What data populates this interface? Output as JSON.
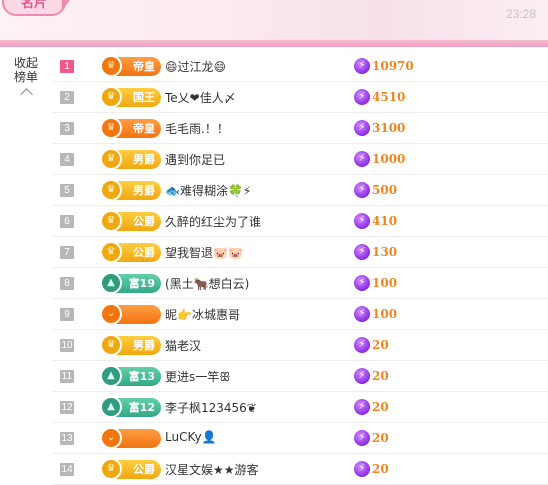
{
  "header": {
    "tag": "名片",
    "time": "23:28",
    "accent": "#f28ab0"
  },
  "sidebar": {
    "line1": "收起",
    "line2": "榜单",
    "icon": "chevron-up-icon"
  },
  "rows": [
    {
      "rank": "1",
      "badge": "帝皇",
      "badge_color": "orange",
      "badge_icon": "crown-icon",
      "name": "😄过江龙😄",
      "score": "10970"
    },
    {
      "rank": "2",
      "badge": "国王",
      "badge_color": "gold",
      "badge_icon": "crown-icon",
      "name": "Te乂❤佳人〆",
      "score": "4510"
    },
    {
      "rank": "3",
      "badge": "帝皇",
      "badge_color": "orange",
      "badge_icon": "crown-icon",
      "name": "毛毛雨.！！",
      "score": "3100"
    },
    {
      "rank": "4",
      "badge": "男爵",
      "badge_color": "gold",
      "badge_icon": "crown-icon",
      "name": "遇到你足已",
      "score": "1000"
    },
    {
      "rank": "5",
      "badge": "男爵",
      "badge_color": "gold",
      "badge_icon": "crown-icon",
      "name": "🐟难得糊涂🍀⚡",
      "score": "500"
    },
    {
      "rank": "6",
      "badge": "公爵",
      "badge_color": "gold",
      "badge_icon": "crown-icon",
      "name": "久醉的红尘为了谁",
      "score": "410"
    },
    {
      "rank": "7",
      "badge": "公爵",
      "badge_color": "gold",
      "badge_icon": "crown-icon",
      "name": "望我智退🐷🐷",
      "score": "130"
    },
    {
      "rank": "8",
      "badge": "富19",
      "badge_color": "teal",
      "badge_icon": "triangle-icon",
      "name": "(黑土🐂想白云)",
      "score": "100"
    },
    {
      "rank": "9",
      "badge": "",
      "badge_color": "orange",
      "badge_icon": "chevron-icon",
      "name": "昵👉冰城惠哥",
      "score": "100"
    },
    {
      "rank": "10",
      "badge": "男爵",
      "badge_color": "gold",
      "badge_icon": "crown-icon",
      "name": "猫老汉",
      "score": "20"
    },
    {
      "rank": "11",
      "badge": "富13",
      "badge_color": "teal",
      "badge_icon": "triangle-icon",
      "name": "更进s一竿ꕥ",
      "score": "20"
    },
    {
      "rank": "12",
      "badge": "富12",
      "badge_color": "teal",
      "badge_icon": "triangle-icon",
      "name": "李子枫123456❦",
      "score": "20"
    },
    {
      "rank": "13",
      "badge": "",
      "badge_color": "orange",
      "badge_icon": "chevron-icon",
      "name": "LuCKy👤",
      "score": "20"
    },
    {
      "rank": "14",
      "badge": "公爵",
      "badge_color": "gold",
      "badge_icon": "crown-icon",
      "name": "汉星文娱★★游客",
      "score": "20"
    }
  ]
}
